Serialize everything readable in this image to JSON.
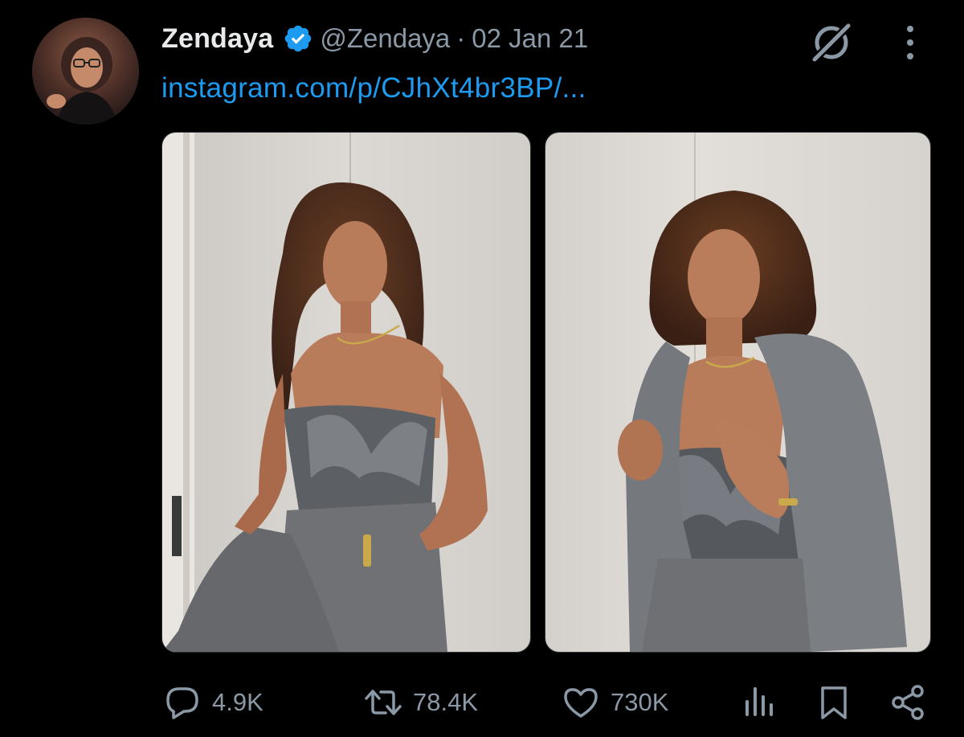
{
  "tweet": {
    "author": {
      "display_name": "Zendaya",
      "handle": "@Zendaya",
      "verified": true
    },
    "separator": "·",
    "date": "02 Jan 21",
    "link_text": "instagram.com/p/CJhXt4br3BP/...",
    "media_count": 2,
    "stats": {
      "replies": "4.9K",
      "retweets": "78.4K",
      "likes": "730K"
    }
  },
  "icons": {
    "verified": "verified-badge-icon",
    "grok": "grok-icon",
    "more": "more-vertical-icon",
    "reply": "reply-icon",
    "retweet": "retweet-icon",
    "like": "heart-icon",
    "views": "views-icon",
    "bookmark": "bookmark-icon",
    "share": "share-icon"
  },
  "colors": {
    "background": "#000000",
    "primary_text": "#e7e9ea",
    "secondary_text": "#8b98a5",
    "link": "#1d9bf0",
    "verified": "#1d9bf0"
  }
}
